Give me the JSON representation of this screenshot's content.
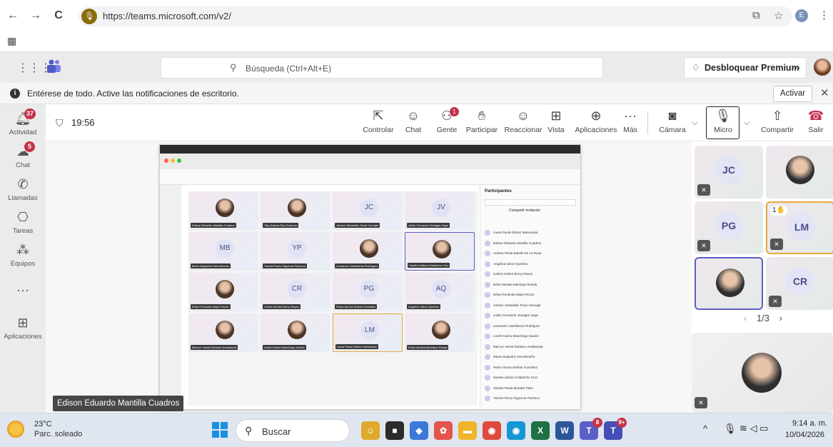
{
  "browser": {
    "back": "←",
    "forward": "→",
    "reload": "C",
    "url": "https://teams.microsoft.com/v2/",
    "profile_letter": "E"
  },
  "header": {
    "search_placeholder": "Búsqueda (Ctrl+Alt+E)",
    "premium_label": "Desbloquear Premium",
    "premium_more": "···"
  },
  "notification": {
    "text": "Entérese de todo. Active las notificaciones de escritorio.",
    "button": "Activar"
  },
  "rail": [
    {
      "label": "Actividad",
      "badge": "37"
    },
    {
      "label": "Chat",
      "badge": "5"
    },
    {
      "label": "Llamadas",
      "badge": ""
    },
    {
      "label": "Tareas",
      "badge": ""
    },
    {
      "label": "Equipos",
      "badge": ""
    },
    {
      "label": "",
      "badge": ""
    },
    {
      "label": "Aplicaciones",
      "badge": ""
    }
  ],
  "meeting": {
    "time": "19:56",
    "toolbar": [
      {
        "label": "Controlar",
        "badge": ""
      },
      {
        "label": "Chat",
        "badge": ""
      },
      {
        "label": "Gente",
        "badge": "1"
      },
      {
        "label": "Participar",
        "badge": ""
      },
      {
        "label": "Reaccionar",
        "badge": ""
      },
      {
        "label": "Vista",
        "badge": ""
      },
      {
        "label": "Aplicaciones",
        "badge": ""
      },
      {
        "label": "Más",
        "badge": ""
      },
      {
        "label": "Cámara",
        "badge": ""
      },
      {
        "label": "Micro",
        "badge": ""
      },
      {
        "label": "Compartir",
        "badge": ""
      },
      {
        "label": "Salir",
        "badge": ""
      }
    ],
    "presenter_name": "Edison Eduardo Mantilla Cuadros",
    "pager": "1/3"
  },
  "shared_screen": {
    "panel_title": "Participantes",
    "invite_label": "Compartir invitación",
    "tiles": [
      {
        "initials": "",
        "photo": true,
        "name": "Edison Eduardo Mantilla Cuadros"
      },
      {
        "initials": "",
        "photo": true,
        "name": "Taty Andrea Rey Guerrero"
      },
      {
        "initials": "JC",
        "photo": false,
        "name": "Johann Sebastián Toran Carvajal"
      },
      {
        "initials": "JV",
        "photo": false,
        "name": "Julian Fernando Venegas Vega"
      },
      {
        "initials": "MB",
        "photo": false,
        "name": "María Alejandra Vera Briceño"
      },
      {
        "initials": "YP",
        "photo": false,
        "name": "Yazmin Rocio Figueroa Pacheco"
      },
      {
        "initials": "",
        "photo": true,
        "name": "Leonardo Castellanos Rodriguez"
      },
      {
        "initials": "",
        "photo": true,
        "name": "Sandra Liliana Cristancho Cruz"
      },
      {
        "initials": "",
        "photo": true,
        "name": "Erika Fernanda Mejía Pinzón"
      },
      {
        "initials": "CR",
        "photo": false,
        "name": "Carlos Andrés Borcy Reyes"
      },
      {
        "initials": "PG",
        "photo": false,
        "name": "Pedro Alonso Bolivar González"
      },
      {
        "initials": "AQ",
        "photo": false,
        "name": "Angelica Varon Quintero"
      },
      {
        "initials": "",
        "photo": true,
        "name": "Marcos Yamid Rubiano Avellaneda"
      },
      {
        "initials": "",
        "photo": true,
        "name": "Lizeth Karina Manchego Suarez"
      },
      {
        "initials": "LM",
        "photo": false,
        "name": "Laura Paola Galvez Manosalva"
      },
      {
        "initials": "",
        "photo": true,
        "name": "Erika Daniela Manrique Rueda"
      }
    ],
    "participants": [
      "Laura Paola Galvez Manosalva",
      "Edison Eduardo Mantilla Cuadros",
      "Andrea Paola Botello De La Rosa",
      "Angelica Varon Quintero",
      "Carlos Andres Borcy Reyes",
      "Erika Daniela Manrique Rueda",
      "Erika Fernanda Mejia Pinzón",
      "Johann Sebastián Toran Carvajal",
      "Julian Fernando Venegas Vega",
      "Leonardo Castellanos Rodriguez",
      "Lizeth Karina Manchego Suarez",
      "Marcos Yamid Rubiano Avellaneda",
      "Maria Alejandra Vera Briceño",
      "Pedro Alonso Bolivar Gonzalez",
      "Sandra Liliana Cristancho Cruz",
      "Sandra Paola Morales Páez",
      "Yazmin Rocio Figueroa Pacheco"
    ]
  },
  "gallery": [
    {
      "initials": "JC",
      "photo": false,
      "muted": true,
      "hand": "",
      "state": ""
    },
    {
      "initials": "",
      "photo": true,
      "muted": false,
      "hand": "",
      "state": ""
    },
    {
      "initials": "PG",
      "photo": false,
      "muted": true,
      "hand": "",
      "state": ""
    },
    {
      "initials": "LM",
      "photo": false,
      "muted": true,
      "hand": "1✋",
      "state": "spk"
    },
    {
      "initials": "",
      "photo": true,
      "muted": false,
      "hand": "",
      "state": "sel"
    },
    {
      "initials": "CR",
      "photo": false,
      "muted": true,
      "hand": "",
      "state": ""
    }
  ],
  "taskbar": {
    "temp": "23°C",
    "weather": "Parc. soleado",
    "search": "Buscar",
    "time": "9:14 a. m.",
    "date": "10/04/2026",
    "apps": [
      {
        "glyph": "☺",
        "color": "#e0a92b",
        "badge": ""
      },
      {
        "glyph": "■",
        "color": "#2b2b2b",
        "badge": ""
      },
      {
        "glyph": "◆",
        "color": "#3c78d8",
        "badge": ""
      },
      {
        "glyph": "✿",
        "color": "#e3554a",
        "badge": ""
      },
      {
        "glyph": "▬",
        "color": "#f0b429",
        "badge": ""
      },
      {
        "glyph": "◉",
        "color": "#dd4b3e",
        "badge": ""
      },
      {
        "glyph": "◉",
        "color": "#1597d4",
        "badge": ""
      },
      {
        "glyph": "X",
        "color": "#1e7145",
        "badge": ""
      },
      {
        "glyph": "W",
        "color": "#2b579a",
        "badge": ""
      },
      {
        "glyph": "T",
        "color": "#5b5fc7",
        "badge": "8"
      },
      {
        "glyph": "T",
        "color": "#464eb8",
        "badge": "9+"
      }
    ]
  },
  "colors": {
    "teams_purple": "#5b5fc7",
    "badge_red": "#c4314b",
    "hand_highlight": "#e5a93a"
  }
}
